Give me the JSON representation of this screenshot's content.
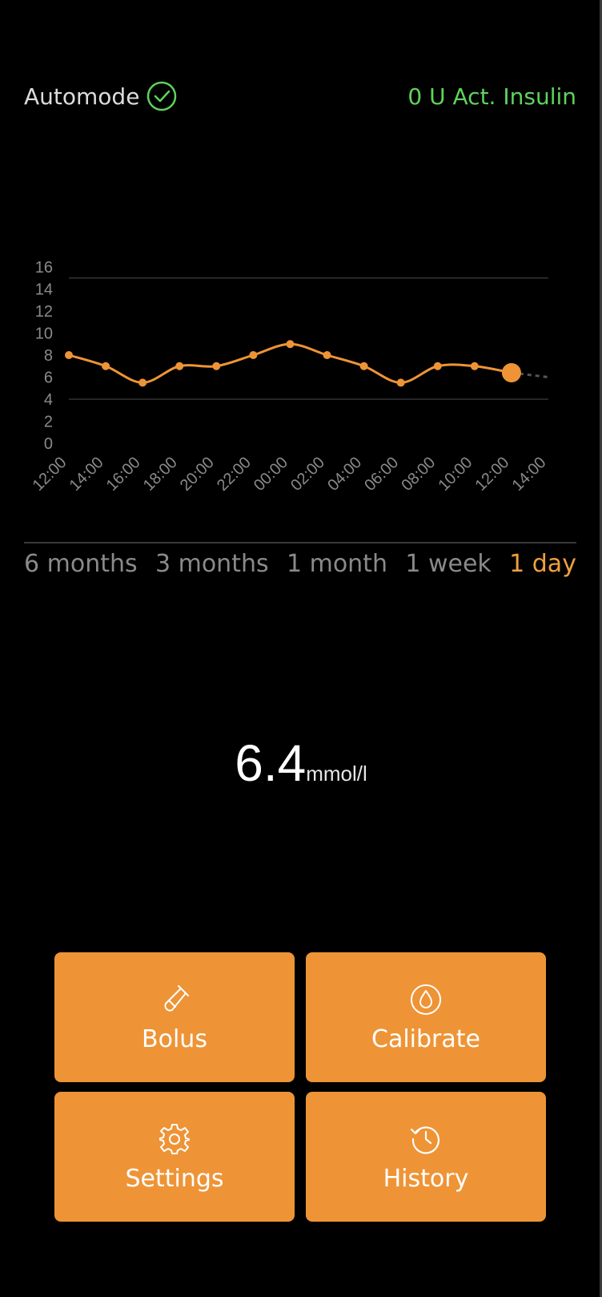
{
  "header": {
    "automode_label": "Automode",
    "active_insulin": "0 U Act. Insulin"
  },
  "colors": {
    "accent": "#ee9436",
    "accent_text": "#f0a040",
    "ok_green": "#5fd35b",
    "background": "#000000"
  },
  "chart_data": {
    "type": "line",
    "title": "",
    "xlabel": "",
    "ylabel": "",
    "ylim": [
      0,
      16
    ],
    "yticks": [
      "0",
      "2",
      "4",
      "6",
      "8",
      "10",
      "12",
      "14",
      "16"
    ],
    "categories": [
      "12:00",
      "14:00",
      "16:00",
      "18:00",
      "20:00",
      "22:00",
      "00:00",
      "02:00",
      "04:00",
      "06:00",
      "08:00",
      "10:00",
      "12:00",
      "14:00"
    ],
    "values": [
      8.0,
      7.0,
      5.5,
      7.0,
      7.0,
      8.0,
      9.0,
      8.0,
      7.0,
      5.5,
      7.0,
      7.0,
      6.4
    ],
    "projection": 6.0,
    "gridlines": [
      4,
      15
    ],
    "grid": false,
    "legend": "none",
    "line_color": "#ee9436"
  },
  "range_tabs": [
    {
      "label": "6 months",
      "active": false
    },
    {
      "label": "3 months",
      "active": false
    },
    {
      "label": "1 month",
      "active": false
    },
    {
      "label": "1 week",
      "active": false
    },
    {
      "label": "1 day",
      "active": true
    }
  ],
  "reading": {
    "value": "6.4",
    "unit": "mmol/l"
  },
  "actions": [
    {
      "label": "Bolus",
      "icon": "test-tube-icon"
    },
    {
      "label": "Calibrate",
      "icon": "droplet-icon"
    },
    {
      "label": "Settings",
      "icon": "gear-icon"
    },
    {
      "label": "History",
      "icon": "history-icon"
    }
  ]
}
